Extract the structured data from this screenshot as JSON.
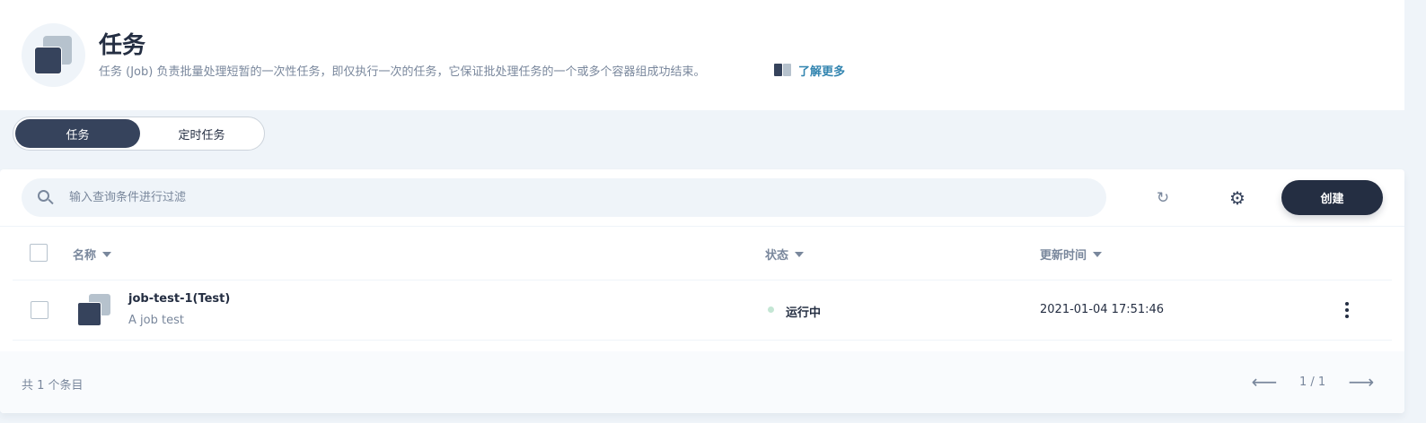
{
  "header": {
    "title": "任务",
    "description": "任务 (Job) 负责批量处理短暂的一次性任务，即仅执行一次的任务，它保证批处理任务的一个或多个容器组成功结束。",
    "learn_more": "了解更多"
  },
  "tabs": [
    {
      "label": "任务",
      "active": true
    },
    {
      "label": "定时任务",
      "active": false
    }
  ],
  "toolbar": {
    "search_placeholder": "输入查询条件进行过滤",
    "refresh_icon": "refresh-icon",
    "settings_icon": "gear-icon",
    "create_label": "创建"
  },
  "table": {
    "columns": [
      "名称",
      "状态",
      "更新时间"
    ],
    "rows": [
      {
        "name": "job-test-1(Test)",
        "description": "A job test",
        "status": "运行中",
        "updated": "2021-01-04 17:51:46"
      }
    ]
  },
  "footer": {
    "total": "共 1 个条目",
    "page": "1 / 1"
  },
  "colors": {
    "primary_dark": "#242e42",
    "accent_link": "#3385b0",
    "muted_text": "#79879c",
    "status_running": "#c4e6d4",
    "page_bg": "#eff4f9"
  }
}
